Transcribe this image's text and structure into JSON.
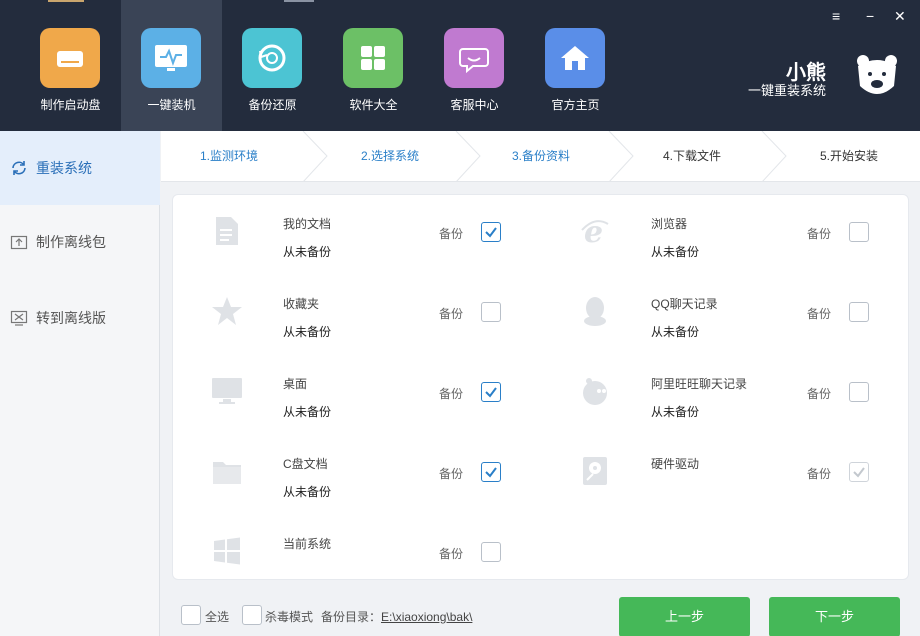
{
  "nav": {
    "items": [
      {
        "label": "制作启动盘",
        "icon": "usb-drive-icon",
        "color": "#f0a84a"
      },
      {
        "label": "一键装机",
        "icon": "monitor-pulse-icon",
        "color": "#5cb0e6"
      },
      {
        "label": "备份还原",
        "icon": "restore-icon",
        "color": "#4cc4d3"
      },
      {
        "label": "软件大全",
        "icon": "apps-grid-icon",
        "color": "#6cc066"
      },
      {
        "label": "客服中心",
        "icon": "chat-bubble-icon",
        "color": "#c07ad0"
      },
      {
        "label": "官方主页",
        "icon": "home-icon",
        "color": "#5a8ee8"
      }
    ]
  },
  "window": {
    "menu": "≡",
    "minimize": "−",
    "close": "✕"
  },
  "brand": {
    "name": "小熊",
    "subtitle": "一键重装系统"
  },
  "sidebar": {
    "items": [
      {
        "label": "重装系统",
        "icon": "refresh-icon"
      },
      {
        "label": "制作离线包",
        "icon": "upload-box-icon"
      },
      {
        "label": "转到离线版",
        "icon": "offline-icon"
      }
    ]
  },
  "steps": [
    {
      "label": "1.监测环境",
      "state": "done"
    },
    {
      "label": "2.选择系统",
      "state": "done"
    },
    {
      "label": "3.备份资料",
      "state": "done"
    },
    {
      "label": "4.下载文件",
      "state": "todo"
    },
    {
      "label": "5.开始安装",
      "state": "todo"
    }
  ],
  "backup_label": "备份",
  "items": [
    {
      "title": "我的文档",
      "status": "从未备份",
      "icon": "document-icon",
      "checked": true,
      "disabled": false
    },
    {
      "title": "浏览器",
      "status": "从未备份",
      "icon": "ie-icon",
      "checked": false,
      "disabled": false
    },
    {
      "title": "收藏夹",
      "status": "从未备份",
      "icon": "star-icon",
      "checked": false,
      "disabled": false
    },
    {
      "title": "QQ聊天记录",
      "status": "从未备份",
      "icon": "qq-icon",
      "checked": false,
      "disabled": false
    },
    {
      "title": "桌面",
      "status": "从未备份",
      "icon": "desktop-icon",
      "checked": true,
      "disabled": false
    },
    {
      "title": "阿里旺旺聊天记录",
      "status": "从未备份",
      "icon": "wangwang-icon",
      "checked": false,
      "disabled": false
    },
    {
      "title": "C盘文档",
      "status": "从未备份",
      "icon": "folder-icon",
      "checked": true,
      "disabled": false
    },
    {
      "title": "硬件驱动",
      "status": "",
      "icon": "driver-disk-icon",
      "checked": true,
      "disabled": true
    },
    {
      "title": "当前系统",
      "status": "",
      "icon": "windows-icon",
      "checked": false,
      "disabled": false
    }
  ],
  "bottom": {
    "select_all": "全选",
    "antivirus_mode": "杀毒模式",
    "dir_label": "备份目录：",
    "dir_path": "E:\\xiaoxiong\\bak\\",
    "prev": "上一步",
    "next": "下一步"
  },
  "colors": {
    "accent": "#2a7fc8",
    "button": "#45b858",
    "header": "#232c3d"
  }
}
